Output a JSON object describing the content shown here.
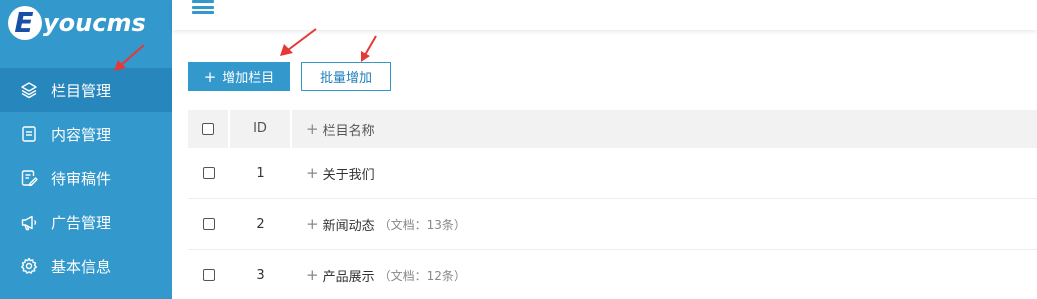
{
  "logo": {
    "letter": "E",
    "text": "youcms"
  },
  "sidebar": {
    "items": [
      {
        "label": "栏目管理",
        "icon": "layers-icon",
        "active": true
      },
      {
        "label": "内容管理",
        "icon": "document-icon",
        "active": false
      },
      {
        "label": "待审稿件",
        "icon": "edit-document-icon",
        "active": false
      },
      {
        "label": "广告管理",
        "icon": "megaphone-icon",
        "active": false
      },
      {
        "label": "基本信息",
        "icon": "gear-icon",
        "active": false
      }
    ]
  },
  "toolbar": {
    "add_label": "增加栏目",
    "add_icon": "+",
    "batch_label": "批量增加"
  },
  "table": {
    "headers": {
      "id": "ID",
      "name": "栏目名称"
    },
    "rows": [
      {
        "id": "1",
        "name": "关于我们",
        "doc_count": ""
      },
      {
        "id": "2",
        "name": "新闻动态",
        "doc_count": "（文档：13条）"
      },
      {
        "id": "3",
        "name": "产品展示",
        "doc_count": "（文档：12条）"
      }
    ]
  },
  "colors": {
    "sidebar": "#3398cc",
    "sidebar_active": "#2787bd",
    "accent": "#3398cc",
    "arrow": "#e53935"
  }
}
